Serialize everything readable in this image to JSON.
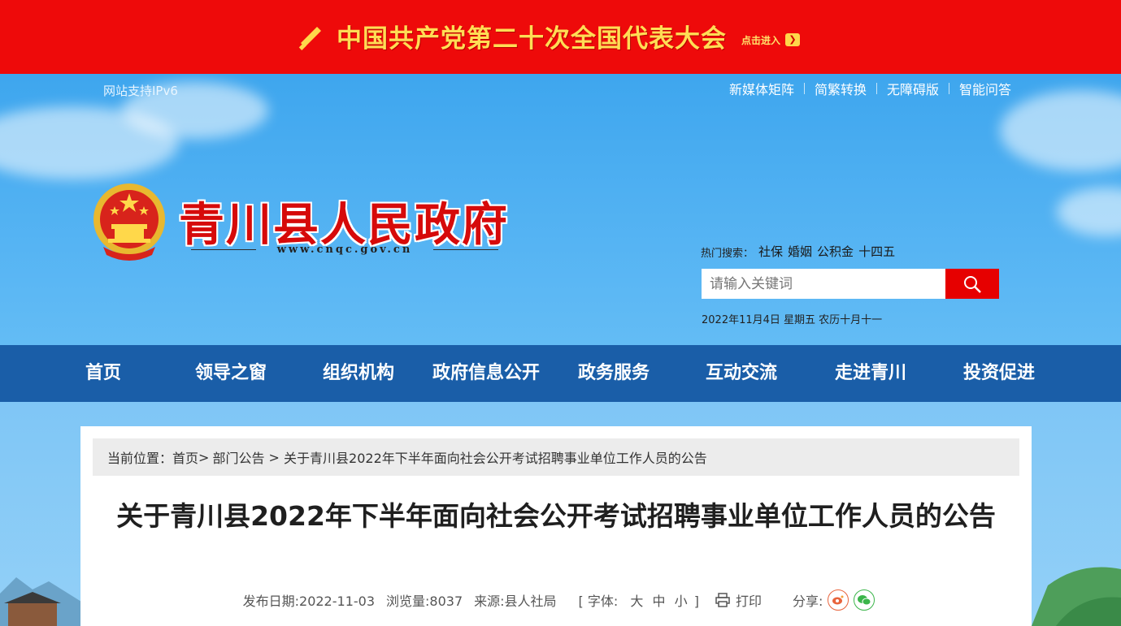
{
  "banner": {
    "title": "中国共产党第二十次全国代表大会",
    "enter": "点击进入"
  },
  "header": {
    "ipv6": "网站支持IPv6",
    "toplinks": [
      "新媒体矩阵",
      "简繁转换",
      "无障碍版",
      "智能问答"
    ],
    "site_title": "青川县人民政府",
    "domain": "www.cnqc.gov.cn",
    "hot_label": "热门搜索：",
    "hot_terms": [
      "社保",
      "婚姻",
      "公积金",
      "十四五"
    ],
    "search_placeholder": "请输入关键词",
    "date": "2022年11月4日 星期五 农历十月十一"
  },
  "nav": [
    "首页",
    "领导之窗",
    "组织机构",
    "政府信息公开",
    "政务服务",
    "互动交流",
    "走进青川",
    "投资促进"
  ],
  "breadcrumb": {
    "label": "当前位置：",
    "home": "首页",
    "sep1": ">",
    "section": "部门公告",
    "sep2": " > ",
    "current": "关于青川县2022年下半年面向社会公开考试招聘事业单位工作人员的公告"
  },
  "article": {
    "title": "关于青川县2022年下半年面向社会公开考试招聘事业单位工作人员的公告",
    "date": "发布日期:2022-11-03",
    "views": "浏览量:8037",
    "source": "来源:县人社局",
    "fontsize_open": "[ 字体:",
    "font_large": "大",
    "font_medium": "中",
    "font_small": "小",
    "fontsize_close": "]",
    "print": "打印",
    "share": "分享:"
  },
  "colors": {
    "banner_red": "#ee0a0a",
    "nav_blue": "#1a5ea8",
    "title_red": "#d60a0a",
    "search_red": "#e60000"
  }
}
